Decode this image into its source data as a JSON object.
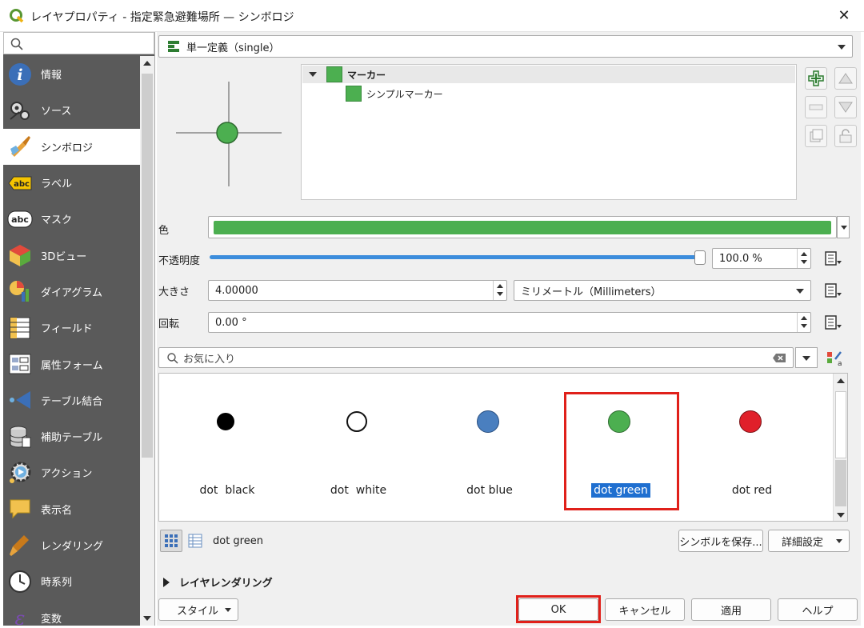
{
  "window": {
    "title": "レイヤプロパティ - 指定緊急避難場所 — シンボロジ",
    "app_icon": "qgis-logo-icon",
    "close_icon": "close-icon",
    "close_glyph": "✕"
  },
  "sidebar": {
    "search_icon": "search-icon",
    "items": [
      {
        "label": "情報",
        "icon": "info-icon"
      },
      {
        "label": "ソース",
        "icon": "source-icon"
      },
      {
        "label": "シンボロジ",
        "icon": "symbology-icon",
        "active": true
      },
      {
        "label": "ラベル",
        "icon": "labels-icon"
      },
      {
        "label": "マスク",
        "icon": "mask-icon"
      },
      {
        "label": "3Dビュー",
        "icon": "3d-view-icon"
      },
      {
        "label": "ダイアグラム",
        "icon": "diagrams-icon"
      },
      {
        "label": "フィールド",
        "icon": "fields-icon"
      },
      {
        "label": "属性フォーム",
        "icon": "attribute-form-icon"
      },
      {
        "label": "テーブル結合",
        "icon": "joins-icon"
      },
      {
        "label": "補助テーブル",
        "icon": "auxiliary-storage-icon"
      },
      {
        "label": "アクション",
        "icon": "actions-icon"
      },
      {
        "label": "表示名",
        "icon": "display-icon"
      },
      {
        "label": "レンダリング",
        "icon": "rendering-icon"
      },
      {
        "label": "時系列",
        "icon": "temporal-icon"
      },
      {
        "label": "変数",
        "icon": "variables-icon"
      }
    ],
    "abc_text": "abc"
  },
  "renderer": {
    "type_label": "単一定義（single）"
  },
  "symbol_tree": {
    "root": "マーカー",
    "child": "シンプルマーカー",
    "color": "#4caf50"
  },
  "properties": {
    "color_label": "色",
    "color_value": "#4caf50",
    "opacity_label": "不透明度",
    "opacity_value": "100.0 %",
    "opacity_fraction": 1.0,
    "size_label": "大きさ",
    "size_value": "4.00000",
    "unit_value": "ミリメートル（Millimeters）",
    "rotation_label": "回転",
    "rotation_value": "0.00 °"
  },
  "favorites": {
    "search_placeholder": "お気に入り",
    "items": [
      {
        "name": "dot  black",
        "color": "#000000"
      },
      {
        "name": "dot  white",
        "color": "#ffffff"
      },
      {
        "name": "dot blue",
        "color": "#4a7fbf"
      },
      {
        "name": "dot green",
        "color": "#4caf50",
        "selected": true
      },
      {
        "name": "dot red",
        "color": "#e0202a"
      }
    ]
  },
  "selected_symbol": "dot green",
  "buttons": {
    "save_symbol": "シンボルを保存...",
    "advanced": "詳細設定",
    "layer_rendering": "レイヤレンダリング",
    "style": "スタイル",
    "ok": "OK",
    "cancel": "キャンセル",
    "apply": "適用",
    "help": "ヘルプ"
  },
  "colors": {
    "accent": "#1f6fd0",
    "highlight": "#e0201a",
    "slider": "#3c8ddc"
  }
}
